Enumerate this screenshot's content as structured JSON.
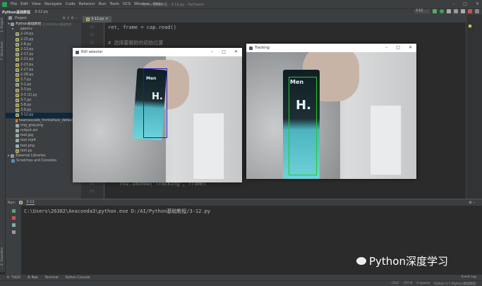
{
  "menu": [
    "File",
    "Edit",
    "View",
    "Navigate",
    "Code",
    "Refactor",
    "Run",
    "Tools",
    "VCS",
    "Window",
    "Help"
  ],
  "window_title": "Python基础教程 - 3-12.py - PyCharm",
  "breadcrumb": [
    "Python基础教程",
    "3-12.py"
  ],
  "run_config": "3-12",
  "project": {
    "header": "Project",
    "root": "Python基础教程",
    "root_path": "D:\\AI\\Python基础教程",
    "items": [
      {
        "name": "opencv",
        "type": "folder"
      },
      {
        "name": "2-14.py",
        "type": "py"
      },
      {
        "name": "2-15.py",
        "type": "py"
      },
      {
        "name": "2-8.py",
        "type": "py"
      },
      {
        "name": "2-13.py",
        "type": "py"
      },
      {
        "name": "2-17.py",
        "type": "py"
      },
      {
        "name": "2-21.py",
        "type": "py"
      },
      {
        "name": "2-23.py",
        "type": "py"
      },
      {
        "name": "2-27.py",
        "type": "py"
      },
      {
        "name": "2-28.py",
        "type": "py"
      },
      {
        "name": "3.7.py",
        "type": "py"
      },
      {
        "name": "3-1.py",
        "type": "py"
      },
      {
        "name": "3-3.py",
        "type": "py"
      },
      {
        "name": "3-3 (2).py",
        "type": "py"
      },
      {
        "name": "3-7.py",
        "type": "py"
      },
      {
        "name": "3-8.py",
        "type": "py"
      },
      {
        "name": "3-9.py",
        "type": "py"
      },
      {
        "name": "3-12.py",
        "type": "py",
        "selected": true
      },
      {
        "name": "haarcascade_frontalface_default.xml",
        "type": "xml"
      },
      {
        "name": "img_gray.png",
        "type": "img"
      },
      {
        "name": "output.avi",
        "type": "img"
      },
      {
        "name": "test.jpg",
        "type": "img"
      },
      {
        "name": "test.mp4",
        "type": "img"
      },
      {
        "name": "test.png",
        "type": "img"
      },
      {
        "name": "test.py",
        "type": "py"
      }
    ],
    "external": "External Libraries",
    "scratches": "Scratches and Consoles"
  },
  "editor": {
    "tab": "3-12.py",
    "lines": [
      {
        "n": "10",
        "text": "ret, frame = cap.read()"
      },
      {
        "n": "11",
        "text": ""
      },
      {
        "n": "12",
        "text": "# 选择要跟踪的初始位置",
        "comment": true
      }
    ],
    "bottom_lines": [
      {
        "n": "22",
        "text": "cv2.imshow(\"Tracking\", frame)"
      },
      {
        "n": "23",
        "text": ""
      }
    ]
  },
  "side_tabs": {
    "project": "1: Project",
    "structure": "7: Structure",
    "favorites": "2: Favorites"
  },
  "run": {
    "label": "Run:",
    "tab": "3-12",
    "output": "C:\\Users\\26382\\Anaconda3\\python.exe D:/AI/Python基础教程/3-12.py"
  },
  "bottom_tabs": [
    "6: TODO",
    "4: Run",
    "Terminal",
    "Python Console"
  ],
  "status": [
    "CRLF",
    "UTF-8",
    "4 spaces",
    "Python 3.7 (Python基础教程)"
  ],
  "event_log": "Event Log",
  "roi_window": {
    "title": "ROI selector",
    "box_color": "#1a1acc"
  },
  "tracking_window": {
    "title": "Tracking",
    "box_color": "#22cc22"
  },
  "bottle_text": {
    "brand": "Men",
    "letter": "H."
  },
  "watermark": "Python深度学习"
}
